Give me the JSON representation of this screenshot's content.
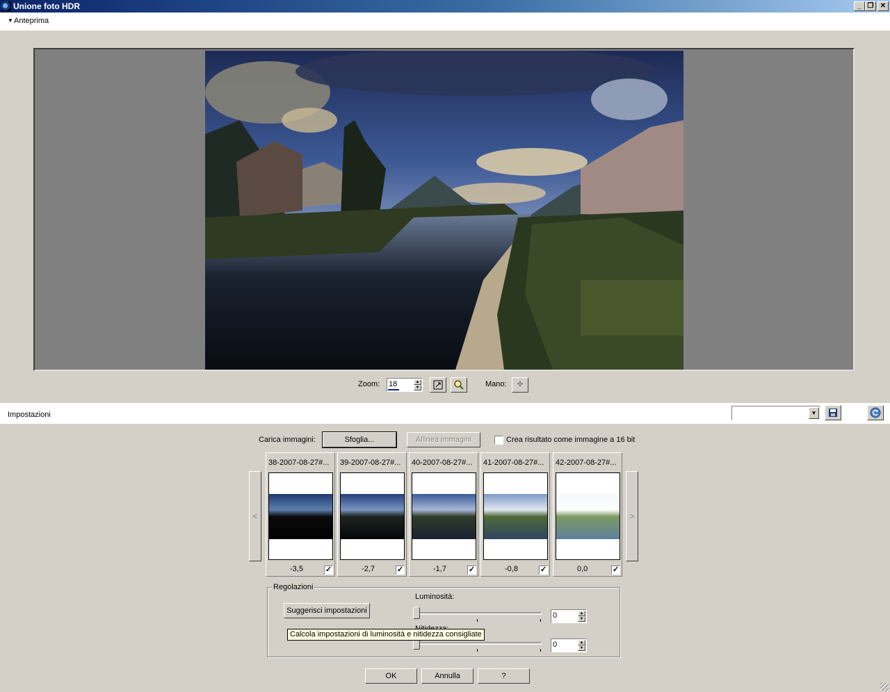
{
  "window": {
    "title": "Unione foto HDR",
    "buttons": {
      "minimize": "_",
      "restore": "❐",
      "close": "✕"
    }
  },
  "preview": {
    "section_label": "Anteprima",
    "zoom_label": "Zoom:",
    "zoom_value": "18",
    "hand_label": "Mano:"
  },
  "settings": {
    "section_label": "Impostazioni",
    "preset_value": "",
    "load_label": "Carica immagini:",
    "browse_button": "Sfoglia...",
    "align_button": "Allinea immagini",
    "create16_label": "Crea risultato come immagine a 16 bit",
    "create16_checked": false,
    "nav_prev": "<",
    "nav_next": ">",
    "thumbnails": [
      {
        "name": "38-2007-08-27#...",
        "ev": "-3,5",
        "checked": true
      },
      {
        "name": "39-2007-08-27#...",
        "ev": "-2,7",
        "checked": true
      },
      {
        "name": "40-2007-08-27#...",
        "ev": "-1,7",
        "checked": true
      },
      {
        "name": "41-2007-08-27#...",
        "ev": "-0,8",
        "checked": true
      },
      {
        "name": "42-2007-08-27#...",
        "ev": "0,0",
        "checked": true
      }
    ],
    "adjustments": {
      "legend": "Regolazioni",
      "suggest_button": "Suggerisci impostazioni",
      "brightness_label": "Luminosità:",
      "brightness_value": "0",
      "sharpness_label": "Nitidezza:",
      "sharpness_value": "0",
      "tooltip": "Calcola impostazioni di luminosità e nitidezza consigliate"
    }
  },
  "footer": {
    "ok": "OK",
    "cancel": "Annulla",
    "help": "?"
  },
  "colors": {
    "face": "#d4d0c8",
    "title_start": "#0a246a",
    "title_end": "#a6caf0",
    "tooltip_bg": "#ffffe1"
  }
}
